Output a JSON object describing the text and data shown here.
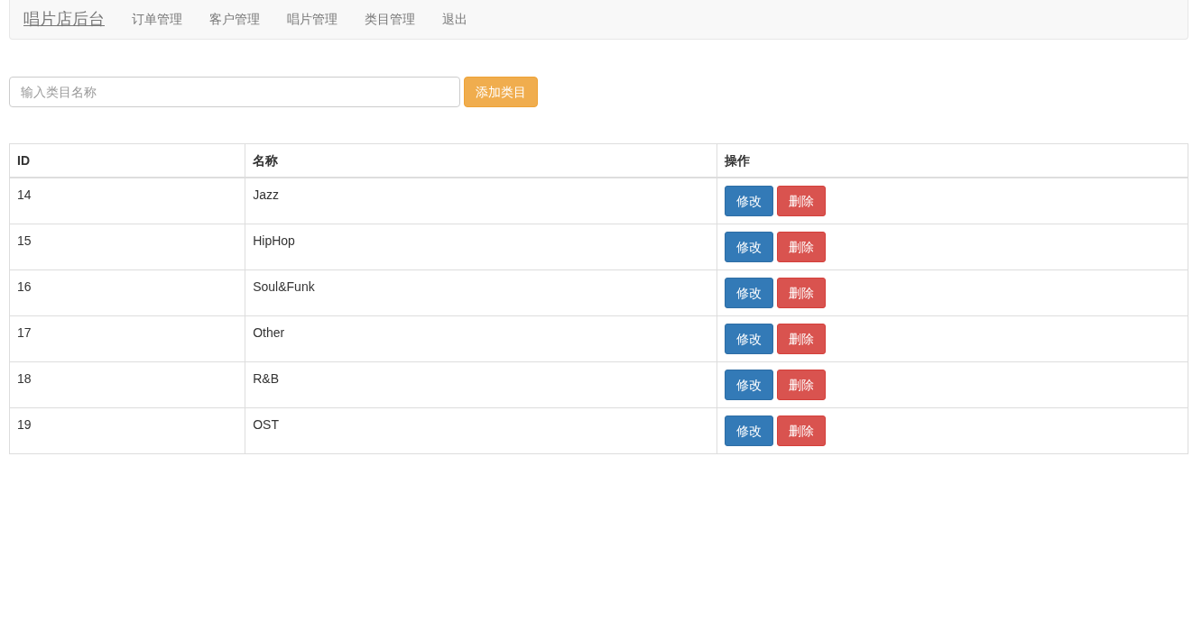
{
  "navbar": {
    "brand": "唱片店后台",
    "items": [
      {
        "label": "订单管理"
      },
      {
        "label": "客户管理"
      },
      {
        "label": "唱片管理"
      },
      {
        "label": "类目管理"
      },
      {
        "label": "退出"
      }
    ]
  },
  "add_form": {
    "placeholder": "输入类目名称",
    "button": "添加类目"
  },
  "table": {
    "columns": [
      "ID",
      "名称",
      "操作"
    ],
    "rows": [
      {
        "id": "14",
        "name": "Jazz",
        "actions": [
          {
            "kind": "edit",
            "label": "修改"
          },
          {
            "kind": "delete",
            "label": "删除"
          }
        ]
      },
      {
        "id": "15",
        "name": "HipHop",
        "actions": [
          {
            "kind": "edit",
            "label": "修改"
          },
          {
            "kind": "delete",
            "label": "删除"
          }
        ]
      },
      {
        "id": "16",
        "name": "Soul&Funk",
        "actions": [
          {
            "kind": "edit",
            "label": "修改"
          },
          {
            "kind": "delete",
            "label": "删除"
          }
        ]
      },
      {
        "id": "17",
        "name": "Other",
        "actions": [
          {
            "kind": "edit",
            "label": "修改"
          },
          {
            "kind": "delete",
            "label": "删除"
          }
        ]
      },
      {
        "id": "18",
        "name": "R&B",
        "actions": [
          {
            "kind": "edit",
            "label": "修改"
          },
          {
            "kind": "delete",
            "label": "删除"
          }
        ]
      },
      {
        "id": "19",
        "name": "OST",
        "actions": [
          {
            "kind": "edit",
            "label": "修改"
          },
          {
            "kind": "delete",
            "label": "删除"
          }
        ]
      }
    ]
  }
}
